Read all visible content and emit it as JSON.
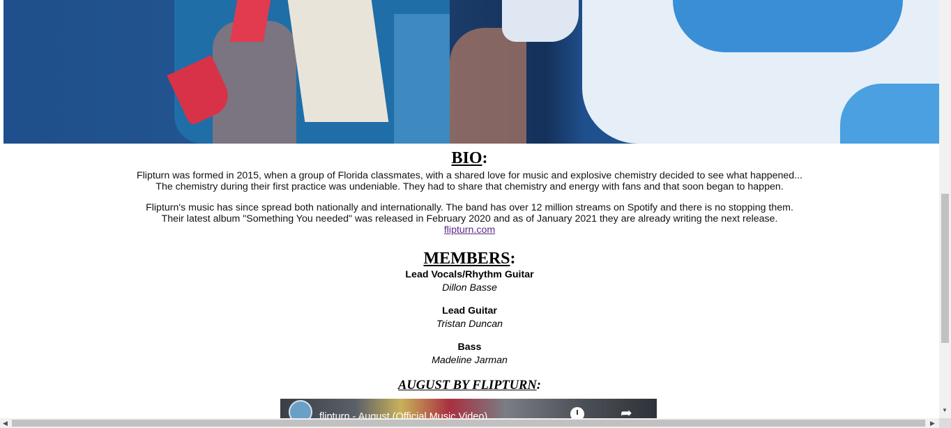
{
  "hero": {
    "image_alt_name": "band-photo"
  },
  "bio": {
    "heading": "BIO",
    "heading_suffix": ":",
    "paragraph1_line1": "Flipturn was formed in 2015, when a group of Florida classmates, with a shared love for music and explosive chemistry decided to see what happened...",
    "paragraph1_line2": "The chemistry during their first practice was undeniable. They had to share that chemistry and energy with fans and that soon began to happen.",
    "paragraph2_line1": "Flipturn's music has since spread both nationally and internationally. The band has over 12 million streams on Spotify and there is no stopping them.",
    "paragraph2_line2": "Their latest album \"Something You needed\" was released in February 2020 and as of January 2021 they are already writing the next release.",
    "link_text": "flipturn.com"
  },
  "members": {
    "heading": "MEMBERS",
    "heading_suffix": ":",
    "list": [
      {
        "role": "Lead Vocals/Rhythm Guitar",
        "name": "Dillon Basse"
      },
      {
        "role": "Lead Guitar",
        "name": "Tristan Duncan"
      },
      {
        "role": "Bass",
        "name": "Madeline Jarman"
      }
    ]
  },
  "song": {
    "heading": "AUGUST BY FLIPTURN",
    "heading_suffix": ":"
  },
  "video": {
    "title": "flipturn - August (Official Music Video)",
    "watch_later_icon": "clock-icon",
    "share_icon": "share-icon"
  },
  "colors": {
    "link": "#5b2a86",
    "hero_blue": "#1f4f8c",
    "scrollbar_thumb": "#c1c1c1"
  }
}
